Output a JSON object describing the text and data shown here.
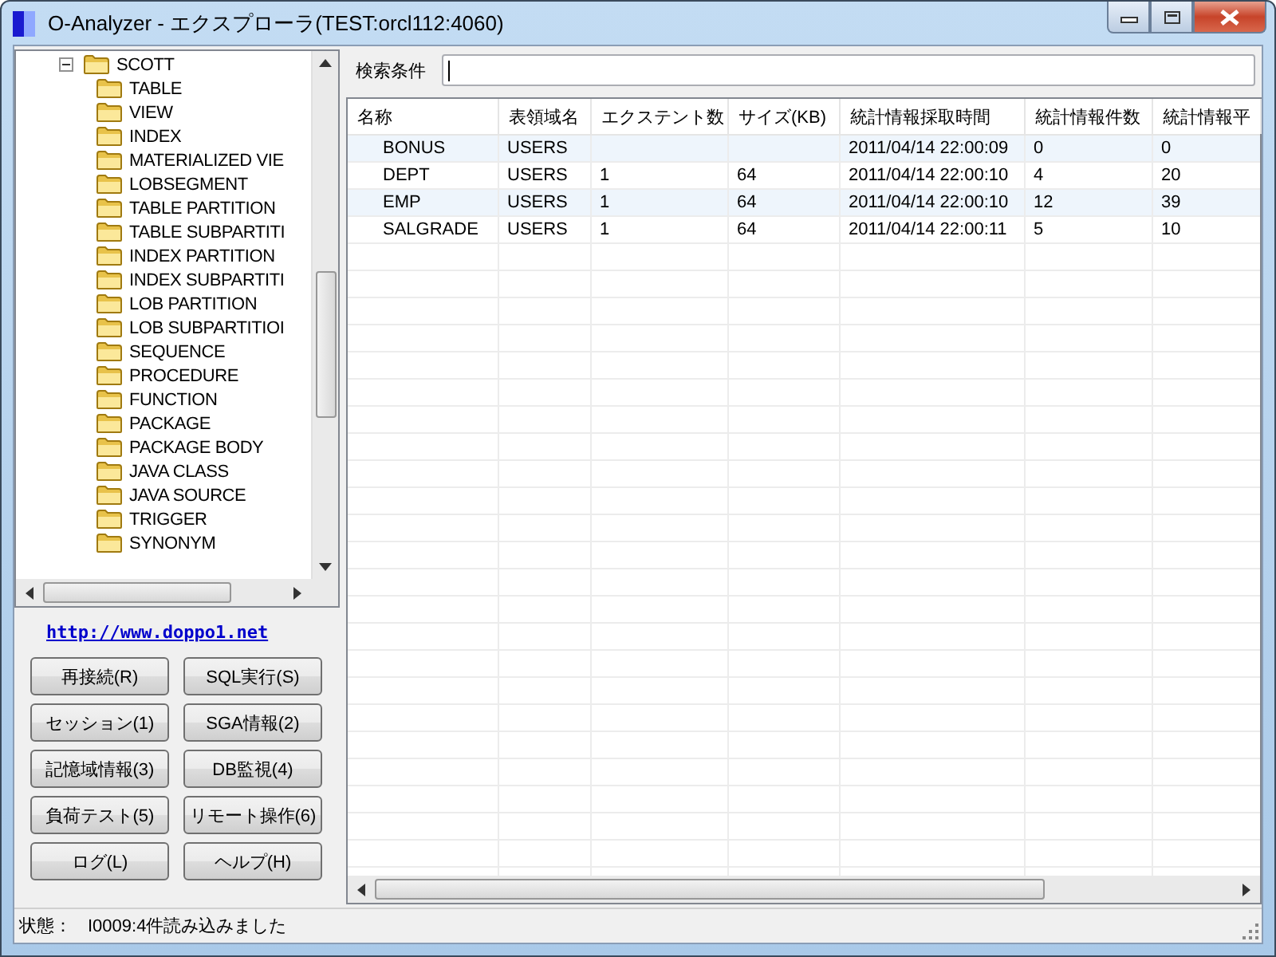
{
  "window": {
    "title": "O-Analyzer - エクスプローラ(TEST:orcl112:4060)"
  },
  "tree": {
    "items": [
      {
        "label": "SCOTT",
        "expanded": true,
        "children": [
          {
            "label": "TABLE"
          },
          {
            "label": "VIEW"
          },
          {
            "label": "INDEX"
          },
          {
            "label": "MATERIALIZED VIE"
          },
          {
            "label": "LOBSEGMENT"
          },
          {
            "label": "TABLE PARTITION"
          },
          {
            "label": "TABLE SUBPARTITI"
          },
          {
            "label": "INDEX PARTITION"
          },
          {
            "label": "INDEX SUBPARTITI"
          },
          {
            "label": "LOB PARTITION"
          },
          {
            "label": "LOB SUBPARTITIOI"
          },
          {
            "label": "SEQUENCE"
          },
          {
            "label": "PROCEDURE"
          },
          {
            "label": "FUNCTION"
          },
          {
            "label": "PACKAGE"
          },
          {
            "label": "PACKAGE BODY"
          },
          {
            "label": "JAVA CLASS"
          },
          {
            "label": "JAVA SOURCE"
          },
          {
            "label": "TRIGGER"
          },
          {
            "label": "SYNONYM"
          }
        ]
      }
    ]
  },
  "link": "http://www.doppo1.net",
  "buttons": [
    "再接続(R)",
    "SQL実行(S)",
    "セッション(1)",
    "SGA情報(2)",
    "記憶域情報(3)",
    "DB監視(4)",
    "負荷テスト(5)",
    "リモート操作(6)",
    "ログ(L)",
    "ヘルプ(H)"
  ],
  "search": {
    "label": "検索条件"
  },
  "table": {
    "columns": [
      "名称",
      "表領域名",
      "エクステント数",
      "サイズ(KB)",
      "統計情報採取時間",
      "統計情報件数",
      "統計情報平"
    ],
    "rows": [
      {
        "cells": [
          "BONUS",
          "USERS",
          null,
          null,
          "2011/04/14 22:00:09",
          "0",
          "0"
        ]
      },
      {
        "cells": [
          "DEPT",
          "USERS",
          "1",
          "64",
          "2011/04/14 22:00:10",
          "4",
          "20"
        ]
      },
      {
        "cells": [
          "EMP",
          "USERS",
          "1",
          "64",
          "2011/04/14 22:00:10",
          "12",
          "39"
        ]
      },
      {
        "cells": [
          "SALGRADE",
          "USERS",
          "1",
          "64",
          "2011/04/14 22:00:11",
          "5",
          "10"
        ]
      }
    ]
  },
  "status_bar": {
    "label": "状態：",
    "text": "I0009:4件読み込みました"
  }
}
